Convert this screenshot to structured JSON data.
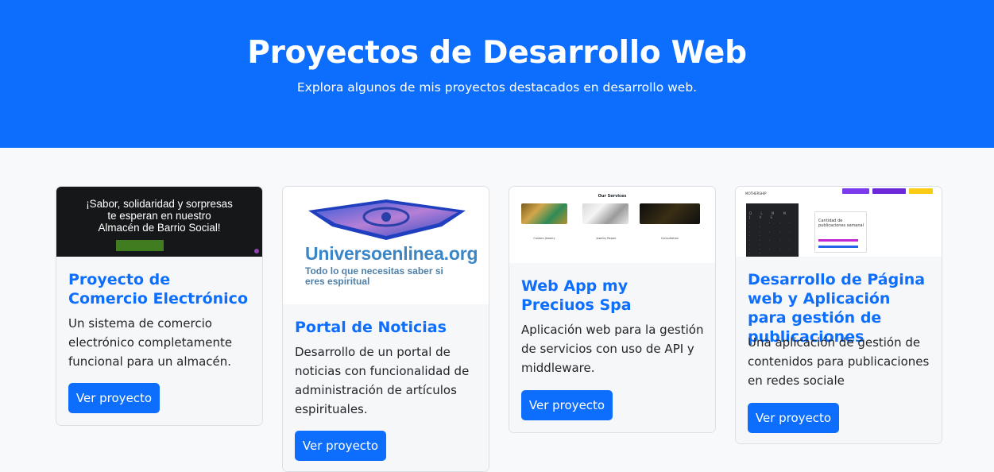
{
  "hero": {
    "title": "Proyectos de Desarrollo Web",
    "subtitle": "Explora algunos de mis proyectos destacados en desarrollo web."
  },
  "colors": {
    "primary": "#0d6efd",
    "page_bg": "#f8f9fa"
  },
  "projects": [
    {
      "title": "Proyecto de Comercio Electrónico",
      "description": "Un sistema de comercio electrónico completamente funcional para un almacén.",
      "button": "Ver proyecto",
      "thumbnail": {
        "line1": "¡Sabor, solidaridad y sorpresas",
        "line2": "te esperan en nuestro",
        "line3": "Almacén de Barrio Social!"
      }
    },
    {
      "title": "Portal de Noticias",
      "description": "Desarrollo de un portal de noticias con funcionalidad de administración de artículos espirituales.",
      "button": "Ver proyecto",
      "thumbnail": {
        "brand": "Universoenlinea.org",
        "tagline": "Todo lo que necesitas saber si eres espiritual"
      }
    },
    {
      "title": "Web App my Preciuos Spa",
      "description": "Aplicación web para la gestión de servicios con uso de API y middleware.",
      "button": "Ver proyecto",
      "thumbnail": {
        "heading": "Our Services",
        "captions": [
          "Custom Jewelry",
          "Jewelry Repair",
          "Consultation"
        ]
      }
    },
    {
      "title": "Desarrollo de Página web y Aplicación para gestión de publicaciones",
      "description": "Una aplicación de gestión de contenidos para publicaciones en redes sociale",
      "button": "Ver proyecto",
      "thumbnail": {
        "logo": "MOTHERSHIP",
        "panel_title": "Cantidad de publicaciones semanal"
      }
    }
  ]
}
